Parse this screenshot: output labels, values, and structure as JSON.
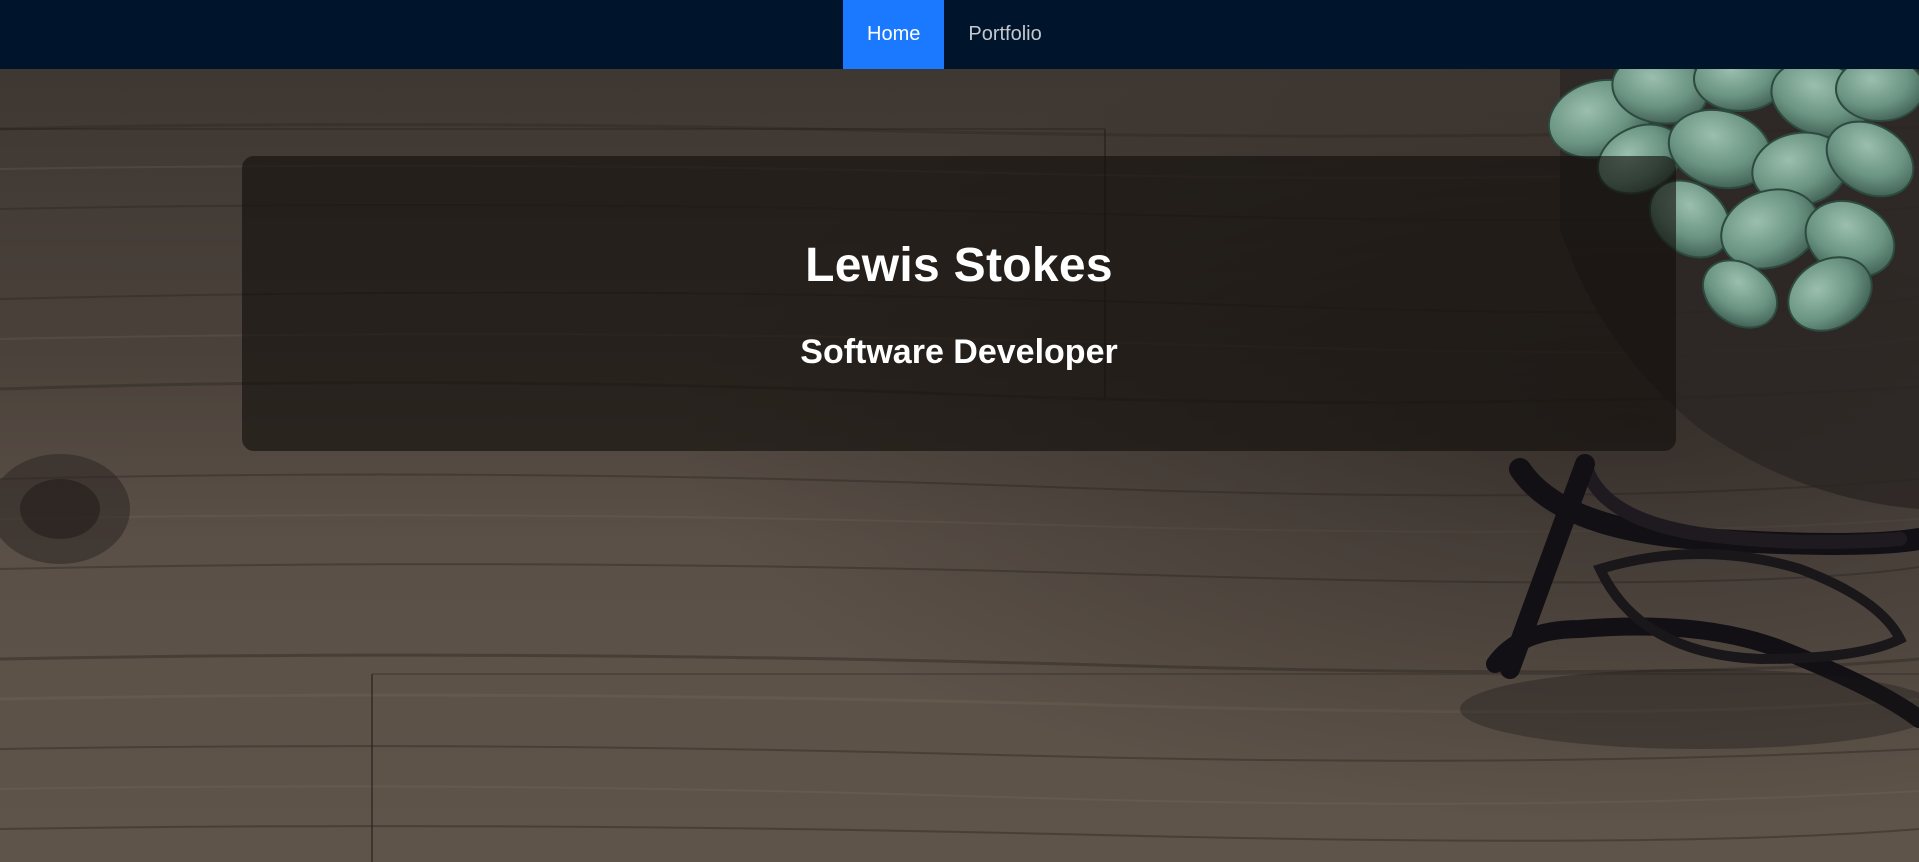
{
  "nav": {
    "items": [
      {
        "label": "Home",
        "active": true
      },
      {
        "label": "Portfolio",
        "active": false
      }
    ],
    "background_color": "#00152b",
    "active_color": "#1a79ff"
  },
  "hero": {
    "name": "Lewis Stokes",
    "role": "Software Developer"
  },
  "background": {
    "description_icons": [
      "wood-desk-texture",
      "succulent-plant",
      "eyeglasses"
    ]
  }
}
